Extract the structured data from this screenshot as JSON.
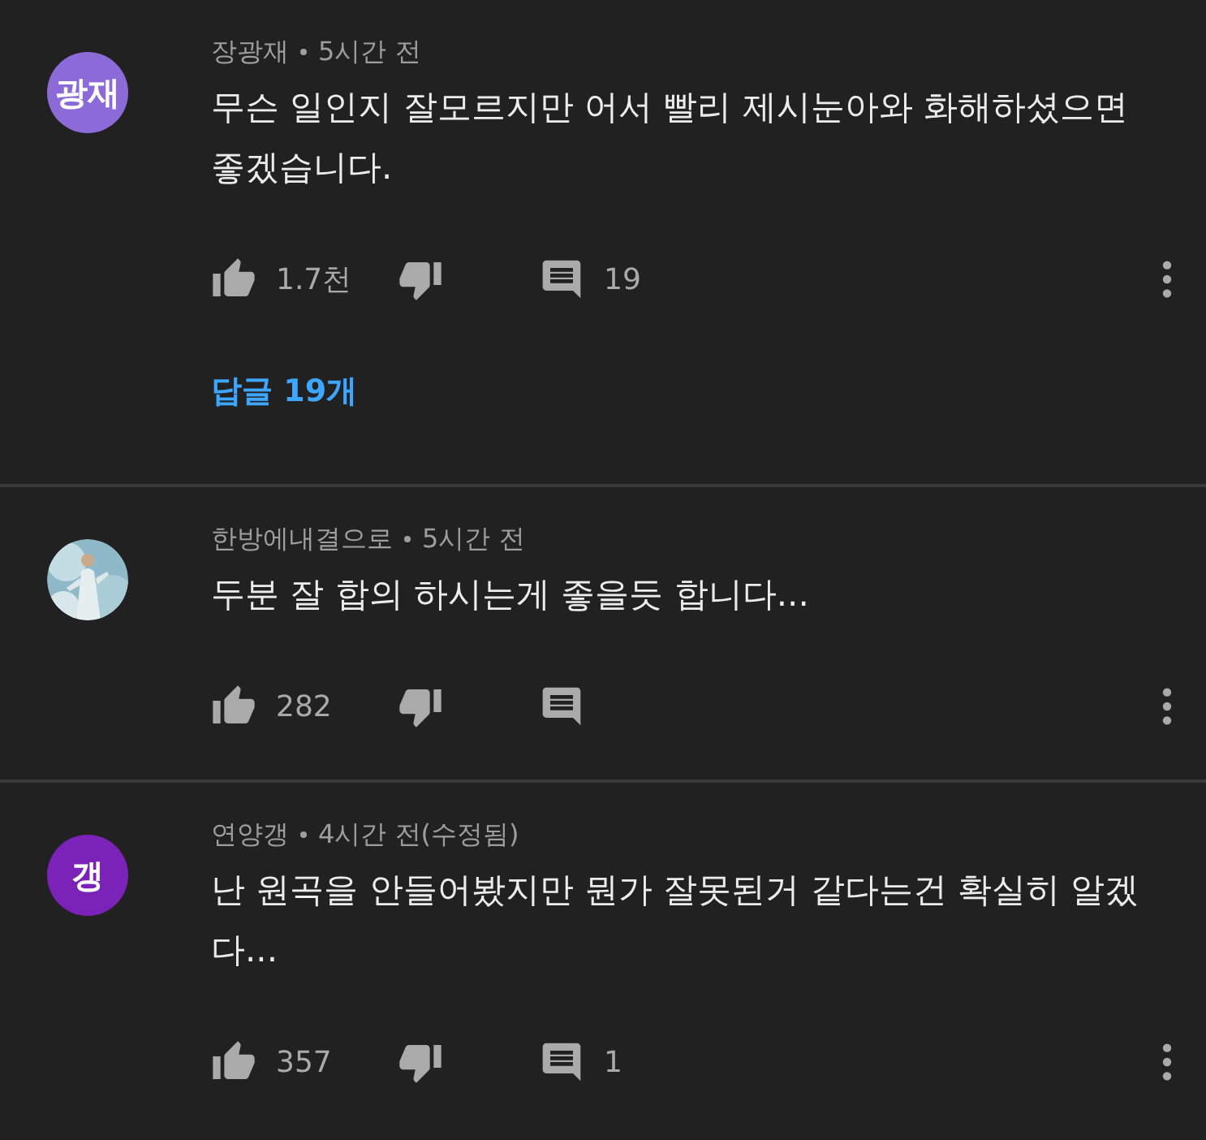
{
  "comments": [
    {
      "avatar": {
        "kind": "initials",
        "text": "광재",
        "color": "#8c6ad8"
      },
      "author": "장광재",
      "time": "5시간 전",
      "body": "무슨 일인지 잘모르지만 어서 빨리 제시눈아와 화해하셨으면 좋겠습니다.",
      "likes": "1.7천",
      "replies_count": "19",
      "replies_link": "답글 19개"
    },
    {
      "author": "한방에내결으로",
      "time": "5시간 전",
      "body": "두분 잘 합의 하시는게 좋을듯 합니다...",
      "likes": "282"
    },
    {
      "avatar": {
        "kind": "initials",
        "text": "갱",
        "color": "#7b22b8"
      },
      "author": "연양갱",
      "time": "4시간 전(수정됨)",
      "body": "난 원곡을 안들어봤지만 뭔가 잘못된거 같다는건 확실히 알겠다...",
      "likes": "357",
      "replies_count": "1"
    }
  ]
}
